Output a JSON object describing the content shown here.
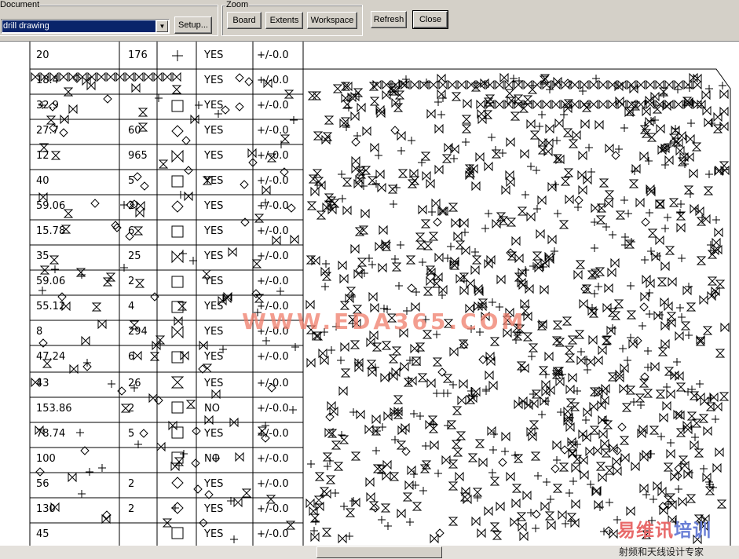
{
  "toolbar": {
    "document_label": "Document",
    "document_value": "drill drawing",
    "setup_label": "Setup...",
    "zoom_label": "Zoom",
    "board_label": "Board",
    "extents_label": "Extents",
    "workspace_label": "Workspace",
    "refresh_label": "Refresh",
    "close_label": "Close"
  },
  "drill_table": {
    "rows": [
      {
        "size": "20",
        "qty": "176",
        "plated": "YES",
        "tol": "+/-0.0"
      },
      {
        "size": "18.4",
        "qty": "",
        "plated": "YES",
        "tol": "+/-0.0"
      },
      {
        "size": "32.9",
        "qty": "",
        "plated": "YES",
        "tol": "+/-0.0"
      },
      {
        "size": "27.7",
        "qty": "60",
        "plated": "YES",
        "tol": "+/-0.0"
      },
      {
        "size": "12",
        "qty": "965",
        "plated": "YES",
        "tol": "+/-0.0"
      },
      {
        "size": "40",
        "qty": "5",
        "plated": "YES",
        "tol": "+/-0.0"
      },
      {
        "size": "59.06",
        "qty": "2",
        "plated": "YES",
        "tol": "+/-0.0"
      },
      {
        "size": "15.78",
        "qty": "6",
        "plated": "YES",
        "tol": "+/-0.0"
      },
      {
        "size": "35",
        "qty": "25",
        "plated": "YES",
        "tol": "+/-0.0"
      },
      {
        "size": "59.06",
        "qty": "2",
        "plated": "YES",
        "tol": "+/-0.0"
      },
      {
        "size": "55.12",
        "qty": "4",
        "plated": "YES",
        "tol": "+/-0.0"
      },
      {
        "size": "8",
        "qty": "294",
        "plated": "YES",
        "tol": "+/-0.0"
      },
      {
        "size": "47.24",
        "qty": "6",
        "plated": "YES",
        "tol": "+/-0.0"
      },
      {
        "size": "43",
        "qty": "26",
        "plated": "YES",
        "tol": "+/-0.0"
      },
      {
        "size": "153.86",
        "qty": "2",
        "plated": "NO",
        "tol": "+/-0.0"
      },
      {
        "size": "78.74",
        "qty": "5",
        "plated": "YES",
        "tol": "+/-0.0"
      },
      {
        "size": "100",
        "qty": "",
        "plated": "NO",
        "tol": "+/-0.0"
      },
      {
        "size": "56",
        "qty": "2",
        "plated": "YES",
        "tol": "+/-0.0"
      },
      {
        "size": "130",
        "qty": "2",
        "plated": "YES",
        "tol": "+/-0.0"
      },
      {
        "size": "45",
        "qty": "",
        "plated": "YES",
        "tol": "+/-0.0"
      }
    ]
  },
  "watermark": "WWW.EDA365.COM",
  "logo": {
    "text_a": "易维讯",
    "text_b": "培训",
    "sub": "射频和天线设计专家"
  },
  "colors": {
    "toolbar_bg": "#d4d0c8",
    "selection": "#0a246a",
    "drawing": "#000000",
    "watermark": "#f07d6a"
  }
}
